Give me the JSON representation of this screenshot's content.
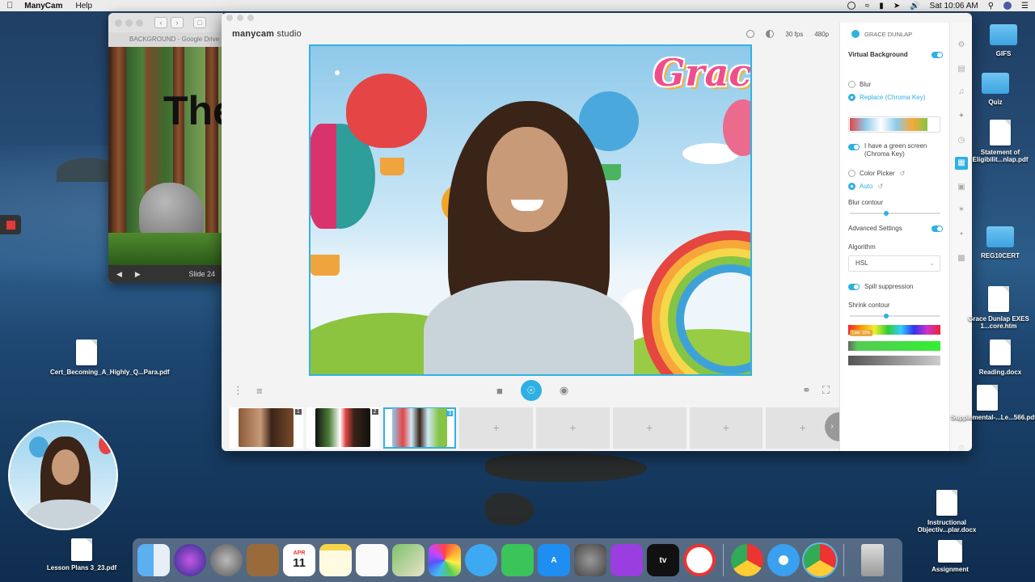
{
  "menubar": {
    "apple_icon": "apple-logo-icon",
    "app_name": "ManyCam",
    "help": "Help",
    "datetime": "Sat 10:06 AM"
  },
  "gdrive": {
    "title": "BACKGROUND - Google Drive",
    "slide_word": "The",
    "slide_label": "Slide 24"
  },
  "manycam": {
    "logo_main": "manycam",
    "logo_sub": "studio",
    "fps": "30 fps",
    "resolution": "480p",
    "user": "GRACE DUNLAP",
    "overlay_text": "Grace",
    "presets": [
      {
        "num": "1",
        "filled": true
      },
      {
        "num": "2",
        "filled": true
      },
      {
        "num": "3",
        "filled": true
      },
      {
        "num": "",
        "filled": false,
        "plus": "+"
      },
      {
        "num": "",
        "filled": false,
        "plus": "+"
      },
      {
        "num": "",
        "filled": false,
        "plus": "+"
      },
      {
        "num": "",
        "filled": false,
        "plus": "+"
      },
      {
        "num": "",
        "filled": false,
        "plus": "+"
      }
    ],
    "panel": {
      "virtual_background": "Virtual Background",
      "blur": "Blur",
      "replace": "Replace (Chroma Key)",
      "green_screen_1": "I have a green screen",
      "green_screen_2": "(Chroma Key)",
      "color_picker": "Color Picker",
      "auto": "Auto",
      "blur_contour": "Blur contour",
      "advanced_settings": "Advanced Settings",
      "algorithm": "Algorithm",
      "algorithm_value": "HSL",
      "spill_suppression": "Spill suppression",
      "shrink_contour": "Shrink contour",
      "tooltip": "Low: 15%"
    }
  },
  "desktop_icons": [
    {
      "label": "GIFS",
      "type": "folder"
    },
    {
      "label": "Quiz",
      "type": "folder"
    },
    {
      "label": "Statement of Eligibilit...nlap.pdf",
      "type": "doc"
    },
    {
      "label": "REG10CERT",
      "type": "folder"
    },
    {
      "label": "Grace Dunlap EXES 1...core.htm",
      "type": "doc"
    },
    {
      "label": "Reading.docx",
      "type": "doc"
    },
    {
      "label": "Supplemental-...Le...566.pdf",
      "type": "doc"
    },
    {
      "label": "Cert_Becoming_A_Highly_Q...Para.pdf",
      "type": "doc"
    },
    {
      "label": "Instructional Objectiv...plar.docx",
      "type": "doc"
    },
    {
      "label": "Lesson Plans 3_23.pdf",
      "type": "doc"
    },
    {
      "label": "Assignment",
      "type": "doc"
    }
  ],
  "dock": {
    "calendar_month": "APR",
    "calendar_day": "11",
    "tv_label": "tv"
  },
  "colors": {
    "accent": "#2fb0e2",
    "menubar": "#ececec"
  }
}
